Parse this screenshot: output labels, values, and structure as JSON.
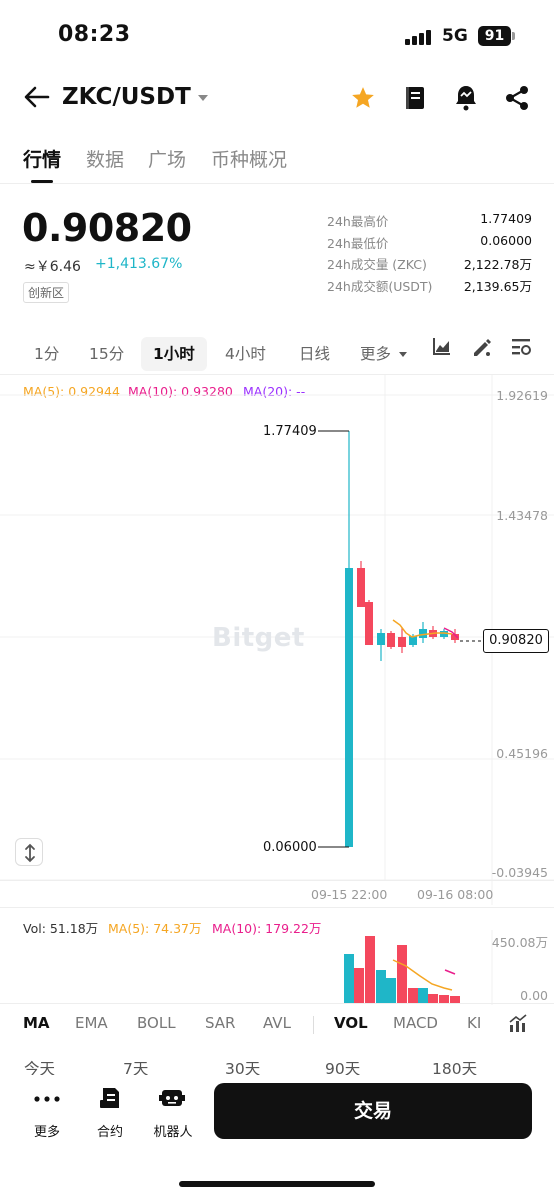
{
  "status_bar": {
    "time": "08:23",
    "network": "5G",
    "battery": "91"
  },
  "header": {
    "pair": "ZKC/USDT"
  },
  "tabs": [
    "行情",
    "数据",
    "广场",
    "币种概况"
  ],
  "ticker": {
    "last_price": "0.90820",
    "cny_price": "≈￥6.46",
    "change": "+1,413.67%",
    "zone_badge": "创新区",
    "stats": [
      {
        "label": "24h最高价",
        "value": "1.77409"
      },
      {
        "label": "24h最低价",
        "value": "0.06000"
      },
      {
        "label": "24h成交量 (ZKC)",
        "value": "2,122.78万"
      },
      {
        "label": "24h成交额(USDT)",
        "value": "2,139.65万"
      }
    ]
  },
  "intervals": [
    "1分",
    "15分",
    "1小时",
    "4小时",
    "日线",
    "更多"
  ],
  "main_chart": {
    "ma5": "MA(5): 0.92944",
    "ma10": "MA(10): 0.93280",
    "ma20": "MA(20): --",
    "y_axis": [
      "1.92619",
      "1.43478",
      "0.45196",
      "-0.03945"
    ],
    "x_axis": [
      "09-15 22:00",
      "09-16 08:00"
    ],
    "high_marker": "1.77409",
    "low_marker": "0.06000",
    "current_price": "0.90820",
    "watermark": "Bitget"
  },
  "volume_chart": {
    "vol": "Vol: 51.18万",
    "ma5": "MA(5): 74.37万",
    "ma10": "MA(10): 179.22万",
    "y_axis": [
      "450.08万",
      "0.00"
    ]
  },
  "indicator_tabs": [
    "MA",
    "EMA",
    "BOLL",
    "SAR",
    "AVL",
    "VOL",
    "MACD",
    "KI"
  ],
  "periods": [
    "今天",
    "7天",
    "30天",
    "90天",
    "180天"
  ],
  "bottom_nav": {
    "more": "更多",
    "contract": "合约",
    "bot": "机器人",
    "trade": "交易"
  },
  "colors": {
    "up": "#1fb6c8",
    "down": "#f4485d",
    "ma5": "#f5a623",
    "ma10": "#e91e8c",
    "ma20": "#9b30ff"
  }
}
